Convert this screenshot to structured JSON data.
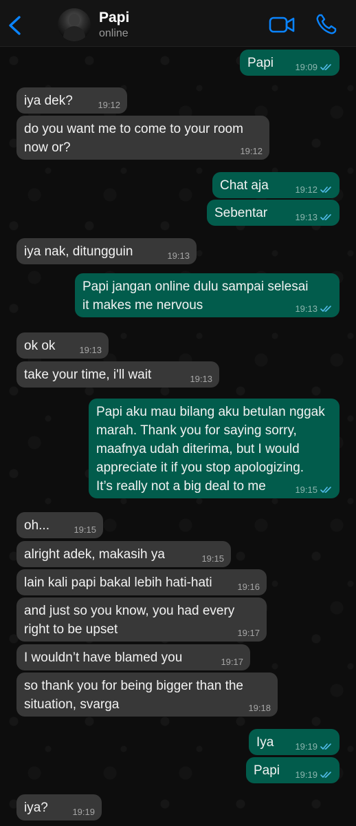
{
  "header": {
    "contact_name": "Papi",
    "contact_status": "online",
    "icons": {
      "back": "chevron-left-icon",
      "video": "video-call-icon",
      "call": "phone-icon",
      "avatar": "avatar"
    },
    "accent": "#0a84ff"
  },
  "colors": {
    "incoming": "#383838",
    "outgoing": "#025c4c",
    "read_ticks": "#53bdeb"
  },
  "messages": [
    {
      "dir": "out",
      "text": "Papi",
      "time": "19:09",
      "read": true
    },
    {
      "dir": "in",
      "text": "iya dek?",
      "time": "19:12"
    },
    {
      "dir": "in",
      "text": "do you want me to come to your room\nnow or?",
      "time": "19:12"
    },
    {
      "dir": "out",
      "text": "Chat aja",
      "time": "19:12",
      "read": true
    },
    {
      "dir": "out",
      "text": "Sebentar",
      "time": "19:13",
      "read": true
    },
    {
      "dir": "in",
      "text": "iya nak, ditungguin",
      "time": "19:13"
    },
    {
      "dir": "out",
      "text": "Papi jangan online dulu sampai selesai\nit makes me nervous",
      "time": "19:13",
      "read": true
    },
    {
      "dir": "in",
      "text": "ok ok",
      "time": "19:13"
    },
    {
      "dir": "in",
      "text": "take your time, i'll wait",
      "time": "19:13"
    },
    {
      "dir": "out",
      "text": "Papi aku mau bilang aku betulan nggak\nmarah. Thank you for saying sorry,\nmaafnya udah diterima, but I would\nappreciate it if you stop apologizing.\nIt’s really not a big deal to me",
      "time": "19:15",
      "read": true
    },
    {
      "dir": "in",
      "text": "oh...",
      "time": "19:15"
    },
    {
      "dir": "in",
      "text": "alright adek, makasih ya",
      "time": "19:15"
    },
    {
      "dir": "in",
      "text": "lain kali papi bakal lebih hati-hati",
      "time": "19:16"
    },
    {
      "dir": "in",
      "text": "and just so you know, you had every\nright to be upset",
      "time": "19:17"
    },
    {
      "dir": "in",
      "text": "I wouldn’t have blamed you",
      "time": "19:17"
    },
    {
      "dir": "in",
      "text": "so thank you for being bigger than the\nsituation, svarga",
      "time": "19:18"
    },
    {
      "dir": "out",
      "text": "Iya",
      "time": "19:19",
      "read": true
    },
    {
      "dir": "out",
      "text": "Papi",
      "time": "19:19",
      "read": true
    },
    {
      "dir": "in",
      "text": "iya?",
      "time": "19:19"
    }
  ]
}
